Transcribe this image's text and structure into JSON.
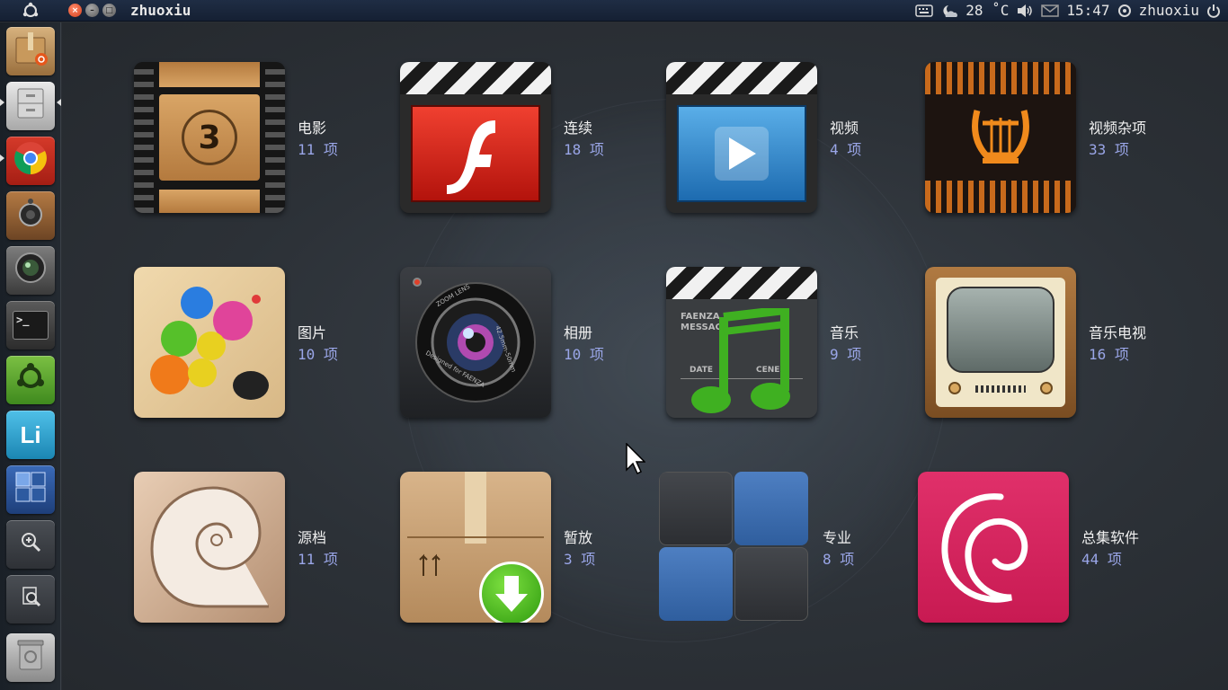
{
  "panel": {
    "dash_icon": "ubuntu-logo-icon",
    "window_title": "zhuoxiu",
    "close_glyph": "×",
    "minimize_glyph": "–",
    "maximize_glyph": "□",
    "keyboard_icon": "keyboard-icon",
    "weather_icon": "weather-night-icon",
    "temperature": "28 ˚C",
    "volume_icon": "speaker-icon",
    "mail_icon": "envelope-icon",
    "time": "15:47",
    "user_icon": "user-switch-icon",
    "username": "zhuoxiu",
    "power_icon": "power-icon"
  },
  "launcher": {
    "items": [
      {
        "name": "ubuntu-software-center",
        "icon": "software-center-icon"
      },
      {
        "name": "files",
        "icon": "file-cabinet-icon"
      },
      {
        "name": "chrome",
        "icon": "chrome-icon"
      },
      {
        "name": "speaker-app",
        "icon": "speaker-box-icon"
      },
      {
        "name": "camera-app",
        "icon": "webcam-icon"
      },
      {
        "name": "terminal",
        "icon": "terminal-icon",
        "glyph": ">_"
      },
      {
        "name": "ubuntu-one",
        "icon": "ubuntu-circle-icon"
      },
      {
        "name": "lingoes",
        "icon": "lingoes-icon",
        "glyph": "Li"
      },
      {
        "name": "workspace-switcher",
        "icon": "workspaces-icon"
      },
      {
        "name": "dash-apps",
        "icon": "zoom-in-icon"
      },
      {
        "name": "dash-files",
        "icon": "file-search-icon"
      },
      {
        "name": "trash",
        "icon": "trash-icon"
      }
    ]
  },
  "categories": [
    {
      "label": "电影",
      "count": "11 项",
      "icon": "film-countdown-icon"
    },
    {
      "label": "连续",
      "count": "18 项",
      "icon": "flash-clapper-icon"
    },
    {
      "label": "视频",
      "count": "4 项",
      "icon": "video-clapper-icon"
    },
    {
      "label": "视频杂项",
      "count": "33 项",
      "icon": "lyre-icon"
    },
    {
      "label": "图片",
      "count": "10 项",
      "icon": "paint-palette-icon"
    },
    {
      "label": "相册",
      "count": "10 项",
      "icon": "camera-lens-icon"
    },
    {
      "label": "音乐",
      "count": "9 项",
      "icon": "music-clapper-icon"
    },
    {
      "label": "音乐电视",
      "count": "16 项",
      "icon": "retro-tv-icon"
    },
    {
      "label": "源档",
      "count": "11 项",
      "icon": "nautilus-shell-icon"
    },
    {
      "label": "暂放",
      "count": "3 项",
      "icon": "package-download-icon"
    },
    {
      "label": "专业",
      "count": "8 项",
      "icon": "grid-tiles-icon"
    },
    {
      "label": "总集软件",
      "count": "44 项",
      "icon": "debian-swirl-icon"
    }
  ],
  "lens_icon_texts": {
    "lens_ring": "ZOOM LENS",
    "lens_spec": "42.5mm-50mm",
    "lens_brand": "Designed for FAENZA",
    "clapper_line1": "FAENZA S",
    "clapper_line2": "MESSAGE",
    "clapper_date": "DATE",
    "clapper_scene": "CENE",
    "countdown": "3"
  },
  "colors": {
    "accent_count": "#9aa6e8",
    "panel_bg": "#1b2638",
    "close_button": "#e0502a",
    "debian_red": "#d81f5a"
  }
}
